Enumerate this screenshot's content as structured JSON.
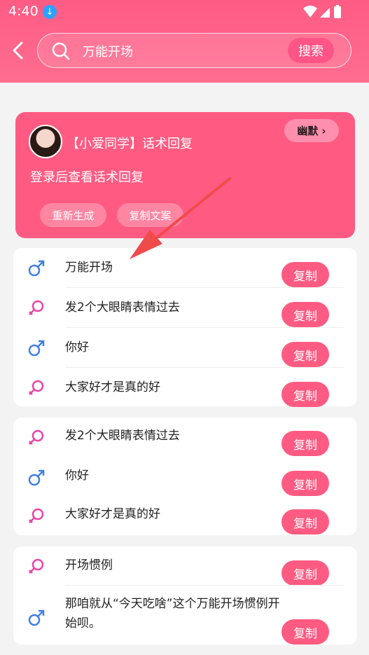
{
  "status_bar": {
    "time": "4:40"
  },
  "search": {
    "query": "万能开场",
    "button_label": "搜索"
  },
  "featured": {
    "title": "【小爱同学】话术回复",
    "tag_label": "幽默",
    "description": "登录后查看话术回复",
    "regenerate_label": "重新生成",
    "copy_text_label": "复制文案"
  },
  "copy_label": "复制",
  "groups": [
    {
      "rows": [
        {
          "gender": "male",
          "text": "万能开场"
        },
        {
          "gender": "female",
          "text": "发2个大眼睛表情过去"
        },
        {
          "gender": "male",
          "text": "你好"
        },
        {
          "gender": "female",
          "text": "大家好才是真的好"
        }
      ]
    },
    {
      "rows": [
        {
          "gender": "female",
          "text": "发2个大眼睛表情过去"
        },
        {
          "gender": "male",
          "text": "你好"
        },
        {
          "gender": "female",
          "text": "大家好才是真的好"
        }
      ]
    },
    {
      "rows": [
        {
          "gender": "female",
          "text": "开场惯例"
        },
        {
          "gender": "male",
          "text": "那咱就从“今天吃啥”这个万能开场惯例开始呗。"
        }
      ]
    }
  ],
  "colors": {
    "accent": "#ff5b82",
    "male_icon": "#3f7fe6",
    "female_icon": "#e944a6"
  }
}
